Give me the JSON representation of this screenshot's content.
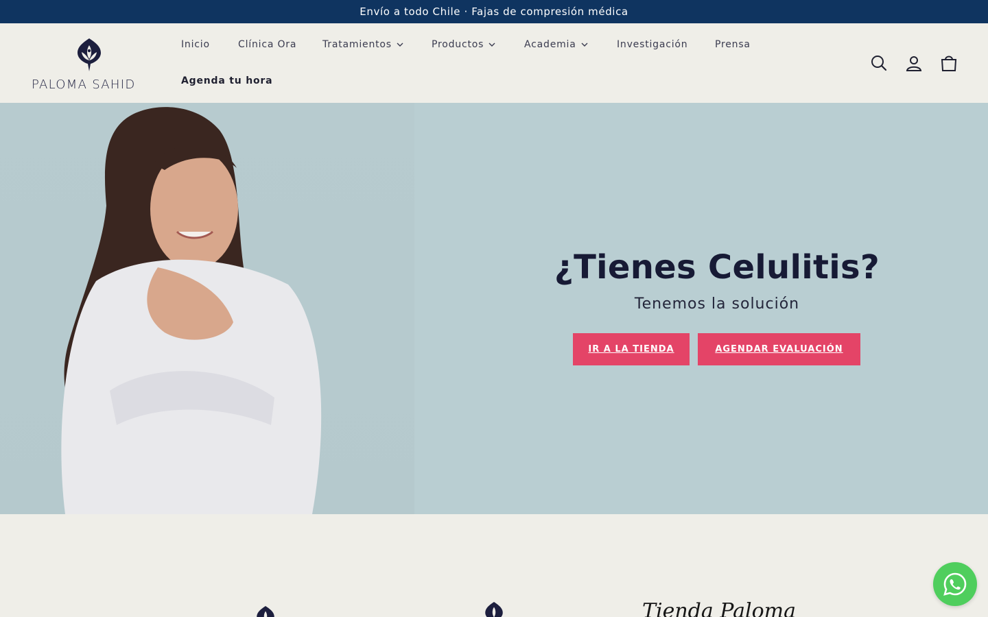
{
  "announcement": {
    "text": "Envío a todo Chile · Fajas de compresión médica"
  },
  "brand": {
    "name": "PALOMA SAHID"
  },
  "nav": {
    "items": [
      {
        "label": "Inicio",
        "has_dropdown": false
      },
      {
        "label": "Clínica Ora",
        "has_dropdown": false
      },
      {
        "label": "Tratamientos",
        "has_dropdown": true
      },
      {
        "label": "Productos",
        "has_dropdown": true
      },
      {
        "label": "Academia",
        "has_dropdown": true
      },
      {
        "label": "Investigación",
        "has_dropdown": false
      },
      {
        "label": "Prensa",
        "has_dropdown": false
      }
    ],
    "cta": "Agenda tu hora"
  },
  "header_icons": [
    "search-icon",
    "account-icon",
    "cart-icon"
  ],
  "hero": {
    "title": "¿Tienes Celulitis?",
    "subtitle": "Tenemos la solución",
    "buttons": {
      "shop": "IR A LA TIENDA",
      "evaluation": "AGENDAR EVALUACIÓN"
    }
  },
  "below_fold": {
    "heading": "Tienda Paloma"
  },
  "colors": {
    "announcement_bg": "#0f3460",
    "page_bg": "#efeee8",
    "hero_bg": "#b9ced2",
    "button_bg": "#e44467",
    "whatsapp": "#4fce5d"
  }
}
